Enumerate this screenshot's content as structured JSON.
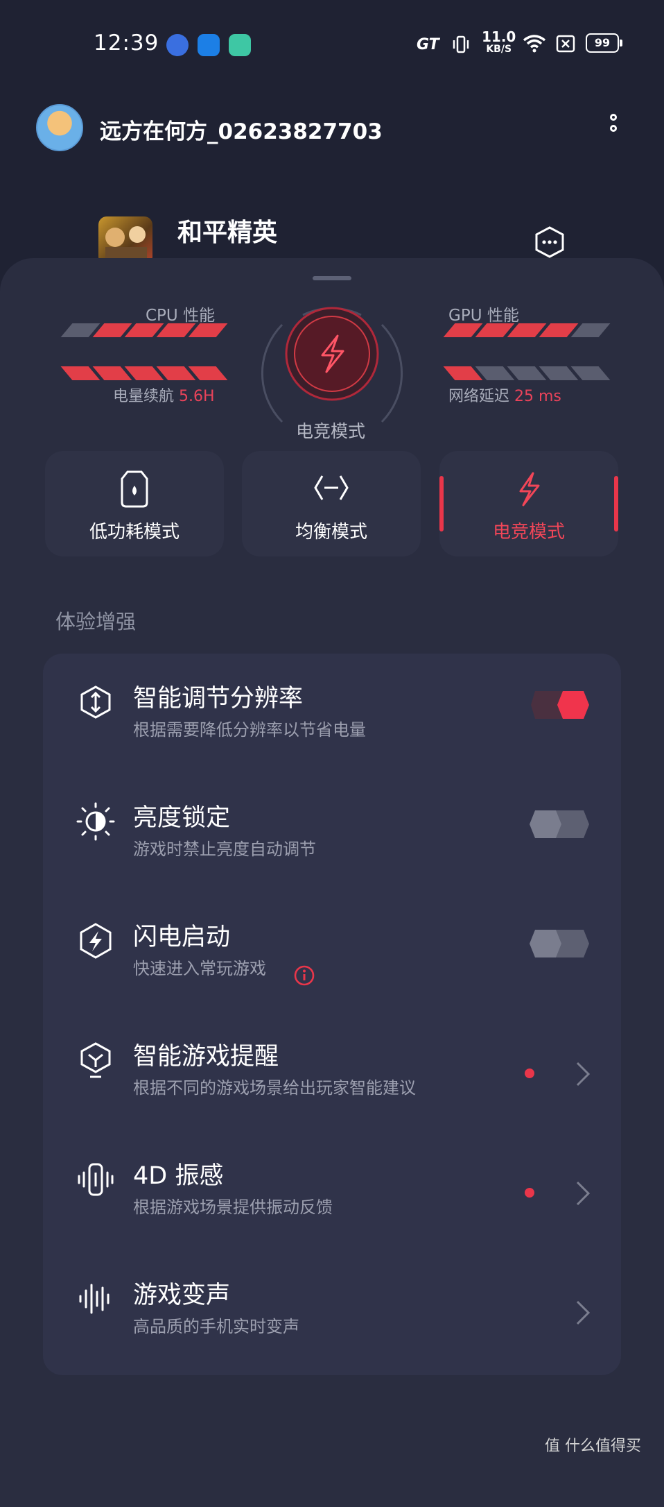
{
  "status_bar": {
    "time": "12:39",
    "apps": [
      {
        "color": "#3a6fe0"
      },
      {
        "color": "#1c7fe6"
      },
      {
        "color": "#3ec7a4"
      }
    ],
    "gt": "GT",
    "speed_value": "11.0",
    "speed_unit": "KB/S",
    "battery": "99"
  },
  "profile": {
    "username": "远方在何方_02623827703",
    "menu_icon": "more-vertical-icon"
  },
  "game": {
    "name": "和平精英",
    "more_icon": "hexagon-more-icon"
  },
  "performance": {
    "cpu_label": "CPU 性能",
    "gpu_label": "GPU 性能",
    "cpu_level": 4,
    "gpu_level": 4,
    "battery_level": 5,
    "network_level": 1,
    "battery_label": "电量续航",
    "battery_value": "5.6H",
    "network_label": "网络延迟",
    "network_value": "25 ms",
    "center_mode_label": "电竞模式",
    "accent": "#e23e48"
  },
  "modes": [
    {
      "label": "低功耗模式",
      "icon": "battery-drop-icon",
      "active": false
    },
    {
      "label": "均衡模式",
      "icon": "balance-icon",
      "active": false
    },
    {
      "label": "电竞模式",
      "icon": "lightning-icon",
      "active": true
    }
  ],
  "section_title": "体验增强",
  "settings": [
    {
      "title": "智能调节分辨率",
      "subtitle": "根据需要降低分辨率以节省电量",
      "icon": "resolution-icon",
      "control": "toggle",
      "on": true
    },
    {
      "title": "亮度锁定",
      "subtitle": "游戏时禁止亮度自动调节",
      "icon": "brightness-icon",
      "control": "toggle",
      "on": false
    },
    {
      "title": "闪电启动",
      "subtitle": "快速进入常玩游戏",
      "icon": "flash-launch-icon",
      "control": "toggle",
      "on": false,
      "info": true
    },
    {
      "title": "智能游戏提醒",
      "subtitle": "根据不同的游戏场景给出玩家智能建议",
      "icon": "smart-reminder-icon",
      "control": "chevron",
      "dot": true
    },
    {
      "title": "4D 振感",
      "subtitle": "根据游戏场景提供振动反馈",
      "icon": "vibration-icon",
      "control": "chevron",
      "dot": true
    },
    {
      "title": "游戏变声",
      "subtitle": "高品质的手机实时变声",
      "icon": "voice-changer-icon",
      "control": "chevron",
      "dot": false
    }
  ],
  "watermark": "值 什么值得买"
}
